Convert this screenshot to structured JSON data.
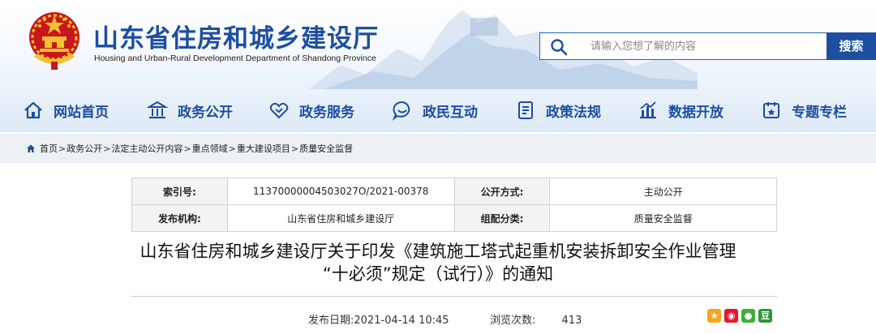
{
  "header": {
    "title": "山东省住房和城乡建设厅",
    "subtitle": "Housing and Urban-Rural Development Department of Shandong Province",
    "search_placeholder": "请输入您想了解的内容",
    "search_button": "搜索"
  },
  "nav": [
    {
      "label": "网站首页",
      "icon": "home-icon"
    },
    {
      "label": "政务公开",
      "icon": "government-building-icon"
    },
    {
      "label": "政务服务",
      "icon": "handshake-icon"
    },
    {
      "label": "政民互动",
      "icon": "chat-bubble-icon"
    },
    {
      "label": "政策法规",
      "icon": "document-icon"
    },
    {
      "label": "数据开放",
      "icon": "bar-chart-icon"
    },
    {
      "label": "专题专栏",
      "icon": "special-topic-icon"
    }
  ],
  "breadcrumb": [
    "首页",
    "政务公开",
    "法定主动公开内容",
    "重点领域",
    "重大建设项目",
    "质量安全监督"
  ],
  "breadcrumb_separator": ">",
  "info": {
    "index_label": "索引号:",
    "index_value": "11370000004503027O/2021-00378",
    "disclosure_label": "公开方式:",
    "disclosure_value": "主动公开",
    "publisher_label": "发布机构:",
    "publisher_value": "山东省住房和城乡建设厅",
    "category_label": "组配分类:",
    "category_value": "质量安全监督"
  },
  "article": {
    "title_line1": "山东省住房和城乡建设厅关于印发《建筑施工塔式起重机安装拆卸安全作业管理",
    "title_line2": "“十必须”规定（试行）》的通知",
    "date_label": "发布日期:",
    "date_value": "2021-04-14 10:45",
    "views_label": "浏览次数:",
    "views_value": "413"
  },
  "share": [
    {
      "icon": "qzone-icon",
      "color": "#f5a623"
    },
    {
      "icon": "weibo-icon",
      "color": "#e6162d"
    },
    {
      "icon": "wechat-icon",
      "color": "#3eb135"
    },
    {
      "icon": "douban-icon",
      "color": "#2e963d"
    }
  ]
}
